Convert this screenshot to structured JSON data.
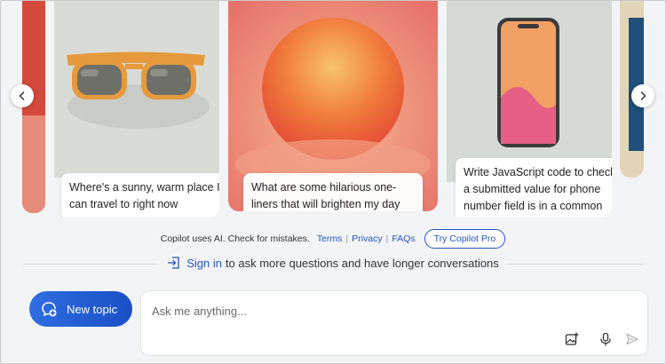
{
  "carousel": {
    "cards": [
      {
        "caption": "Where's a sunny, warm place I can travel to right now"
      },
      {
        "caption": "What are some hilarious one-liners that will brighten my day"
      },
      {
        "caption": "Write JavaScript code to check if a submitted value for phone number field is in a common format"
      }
    ],
    "icons": {
      "prev": "chevron-left-icon",
      "next": "chevron-right-icon"
    }
  },
  "disclaimer": {
    "text": "Copilot uses AI. Check for mistakes.",
    "links": [
      "Terms",
      "Privacy",
      "FAQs"
    ],
    "pro_button": "Try Copilot Pro"
  },
  "signin": {
    "link": "Sign in",
    "rest": "to ask more questions and have longer conversations"
  },
  "new_topic": {
    "label": "New topic",
    "icon": "new-chat-icon"
  },
  "compose": {
    "placeholder": "Ask me anything...",
    "icons": [
      "image-upload-icon",
      "microphone-icon",
      "send-icon"
    ]
  },
  "colors": {
    "accent": "#2455c2",
    "button": "#2f6de1",
    "background": "#f3f4f6"
  }
}
